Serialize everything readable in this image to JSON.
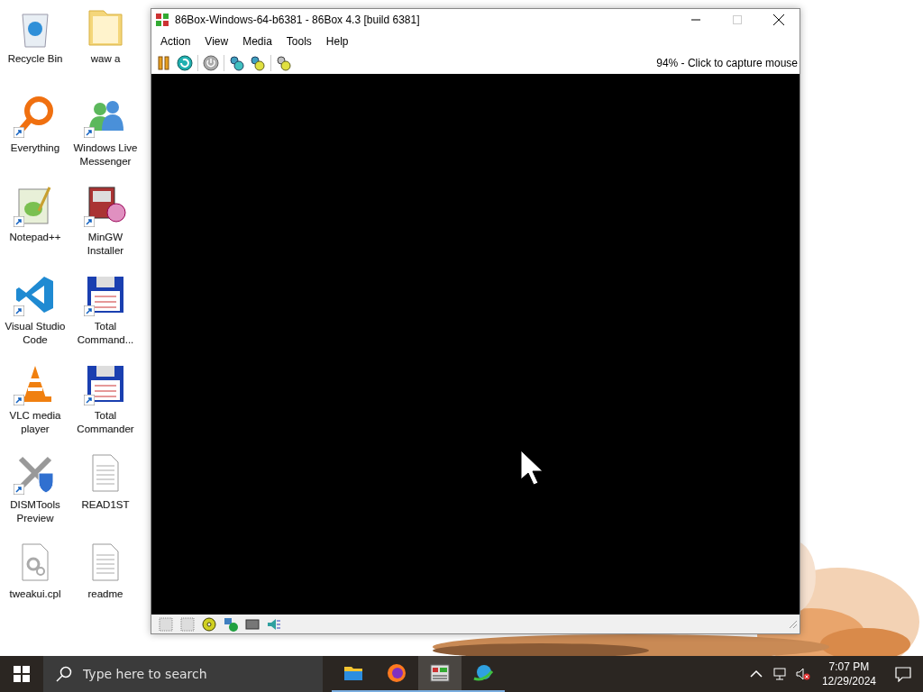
{
  "desktop_icons": [
    {
      "label": "Recycle Bin",
      "kind": "bin",
      "shortcut": false
    },
    {
      "label": "waw a",
      "kind": "folder",
      "shortcut": false
    },
    {
      "label": "Everything",
      "kind": "magnifier",
      "shortcut": true
    },
    {
      "label": "Windows Live Messenger",
      "kind": "people",
      "shortcut": true
    },
    {
      "label": "Notepad++",
      "kind": "notepad",
      "shortcut": true
    },
    {
      "label": "MinGW Installer",
      "kind": "installer",
      "shortcut": true
    },
    {
      "label": "Visual Studio Code",
      "kind": "code",
      "shortcut": true
    },
    {
      "label": "Total Command...",
      "kind": "floppy",
      "shortcut": true
    },
    {
      "label": "VLC media player",
      "kind": "cone",
      "shortcut": true
    },
    {
      "label": "Total Commander",
      "kind": "floppy",
      "shortcut": true
    },
    {
      "label": "DISMTools Preview",
      "kind": "tools",
      "shortcut": true
    },
    {
      "label": "READ1ST",
      "kind": "document",
      "shortcut": false
    },
    {
      "label": "tweakui.cpl",
      "kind": "settings",
      "shortcut": false
    },
    {
      "label": "readme",
      "kind": "document",
      "shortcut": false
    }
  ],
  "window": {
    "title": "86Box-Windows-64-b6381 - 86Box 4.3 [build 6381]",
    "menu": [
      "Action",
      "View",
      "Media",
      "Tools",
      "Help"
    ],
    "status_text": "94% - Click to capture mouse"
  },
  "taskbar": {
    "search": {
      "placeholder": "Type here to search"
    },
    "apps": [
      {
        "kind": "folder",
        "selected": false
      },
      {
        "kind": "browser",
        "selected": false
      },
      {
        "kind": "emulator",
        "selected": true
      },
      {
        "kind": "download",
        "selected": false
      }
    ],
    "time": "7:07 PM",
    "date": "12/29/2024"
  }
}
